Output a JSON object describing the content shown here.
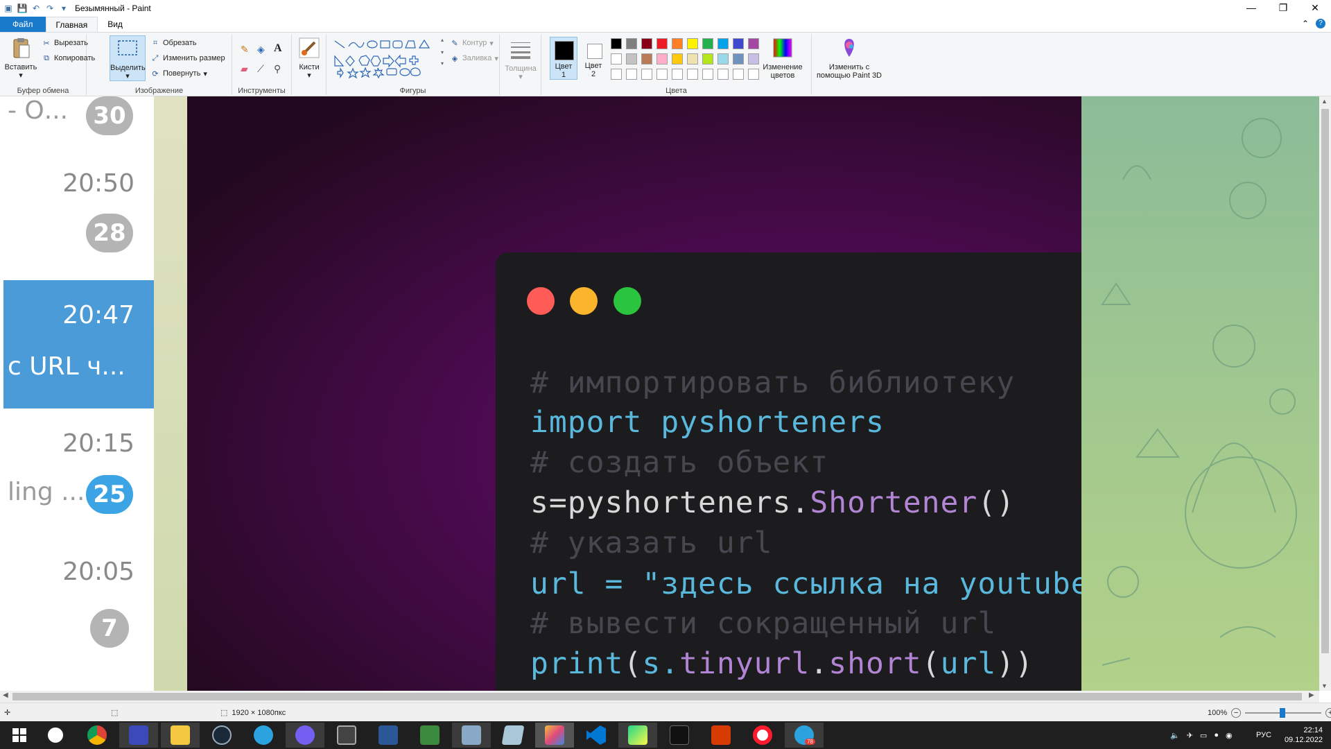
{
  "window": {
    "title": "Безымянный - Paint"
  },
  "ribbon_tabs": [
    "Файл",
    "Главная",
    "Вид"
  ],
  "clipboard": {
    "paste": "Вставить",
    "cut": "Вырезать",
    "copy": "Копировать",
    "group": "Буфер обмена"
  },
  "image": {
    "select": "Выделить",
    "crop": "Обрезать",
    "resize": "Изменить размер",
    "rotate": "Повернуть",
    "group": "Изображение"
  },
  "tools": {
    "group": "Инструменты"
  },
  "brushes": {
    "label": "Кисти"
  },
  "shapes": {
    "outline": "Контур",
    "fill": "Заливка",
    "group": "Фигуры"
  },
  "size": {
    "label": "Толщина"
  },
  "colors": {
    "color1": "Цвет 1",
    "color1_label": "Цвет",
    "color1_num": "1",
    "color2_label": "Цвет",
    "color2_num": "2",
    "edit": "Изменение цветов",
    "paint3d": "Изменить с помощью Paint 3D",
    "group": "Цвета",
    "palette_row1": [
      "#000000",
      "#7f7f7f",
      "#880015",
      "#ed1c24",
      "#ff7f27",
      "#fff200",
      "#22b14c",
      "#00a2e8",
      "#3f48cc",
      "#a349a4"
    ],
    "palette_row2": [
      "#ffffff",
      "#c3c3c3",
      "#b97a57",
      "#ffaec9",
      "#ffc90e",
      "#efe4b0",
      "#b5e61d",
      "#99d9ea",
      "#7092be",
      "#c8bfe7"
    ]
  },
  "chat_list": [
    {
      "snippet": "- О...",
      "badge": "30"
    },
    {
      "time": "20:50",
      "badge": "28"
    },
    {
      "time": "20:47",
      "snippet": "с URL ч..."
    },
    {
      "time": "20:15",
      "snippet": "ling ...",
      "badge": "25"
    },
    {
      "time": "20:05",
      "badge": "7"
    }
  ],
  "code": {
    "line1": "# импортировать библиотеку",
    "line2_kw": "import",
    "line2_mod": "pyshorteners",
    "line3": "# создать объект",
    "line4_a": "s=pyshorteners.",
    "line4_b": "Shortener",
    "line4_c": "()",
    "line5": "# указать url",
    "line6_a": "url = ",
    "line6_b": "\"здесь ссылка на youtube\"",
    "line7": "# вывести сокращенный url",
    "line8_a": "print",
    "line8_b": "(",
    "line8_c": "s.",
    "line8_d": "tinyurl",
    "line8_e": ".",
    "line8_f": "short",
    "line8_g": "(",
    "line8_h": "url",
    "line8_i": "))"
  },
  "status": {
    "dimensions": "1920 × 1080пкс",
    "zoom": "100%"
  },
  "tray": {
    "lang": "РУС",
    "time": "22:14",
    "date": "09.12.2022",
    "telegram_badge": "78"
  }
}
